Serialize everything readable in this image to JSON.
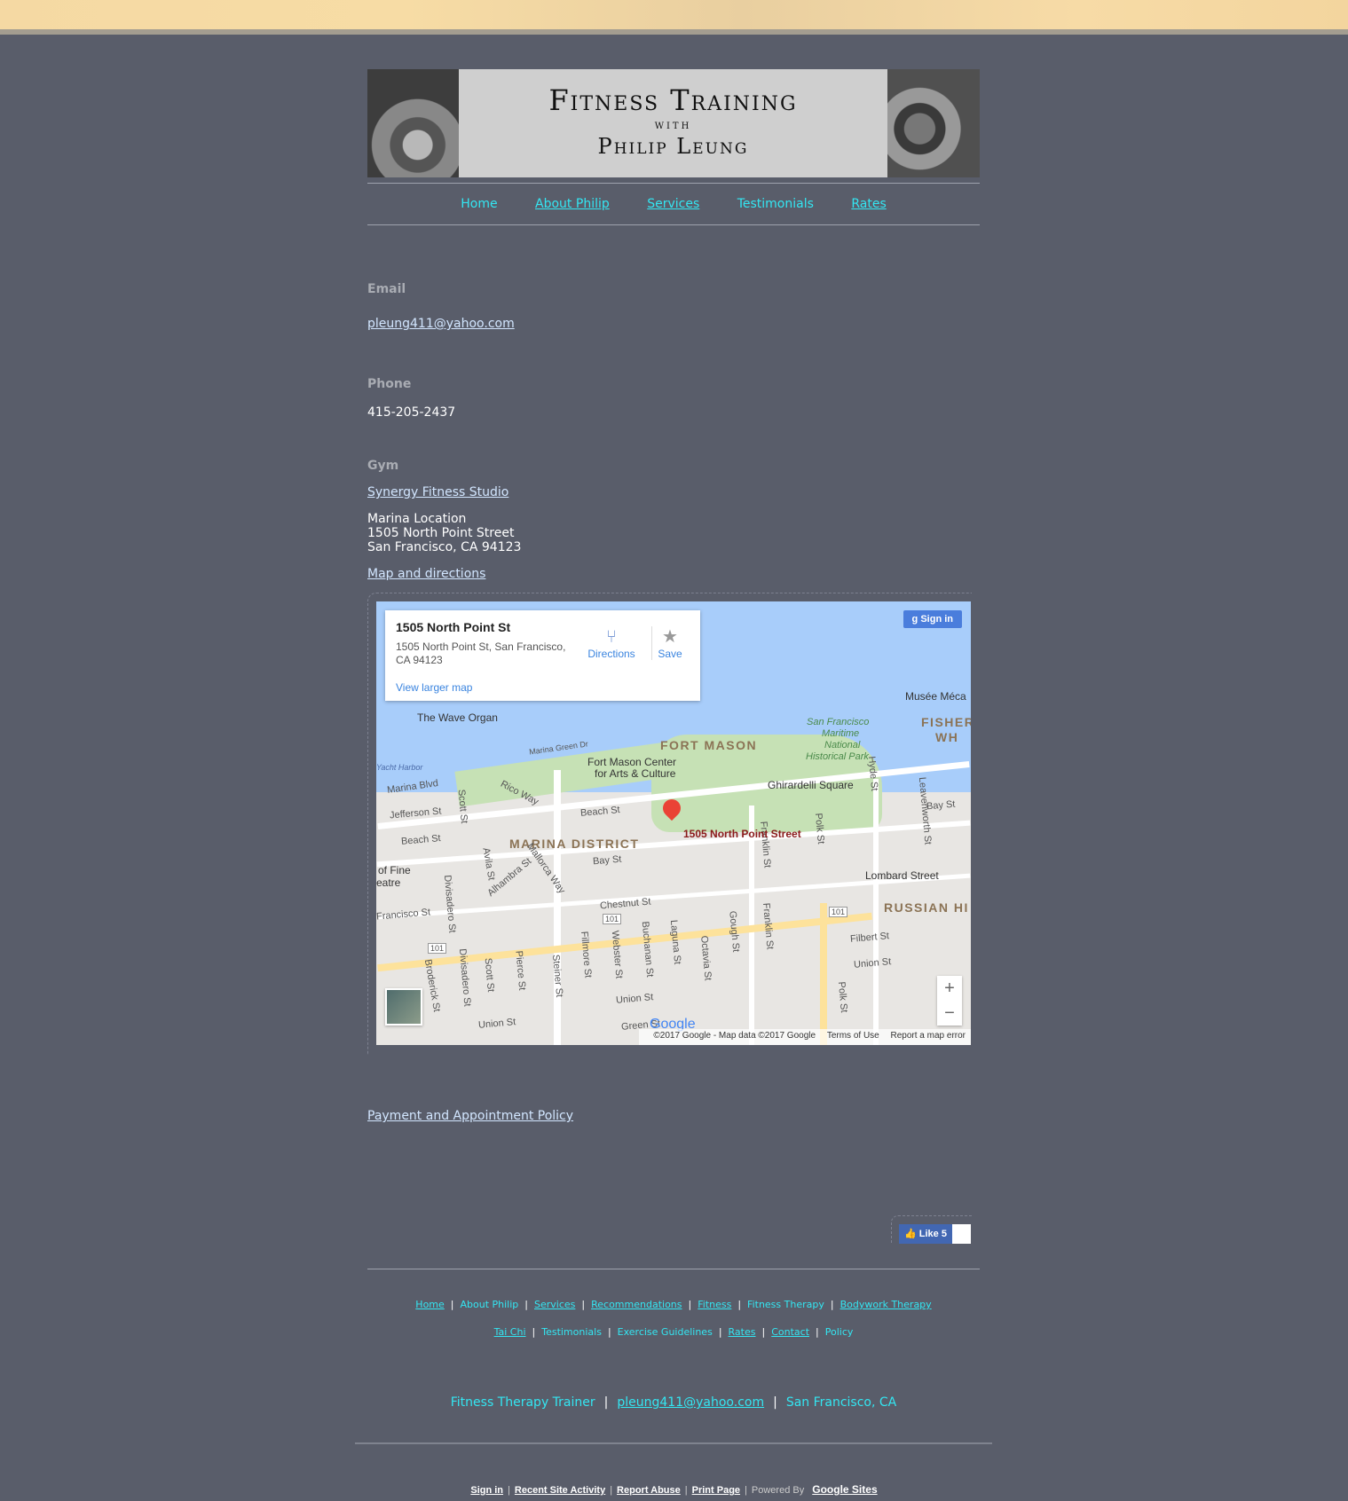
{
  "header": {
    "title_line1": "Fitness Training",
    "title_line2": "with",
    "title_line3": "Philip Leung"
  },
  "nav": {
    "items": [
      {
        "label": "Home"
      },
      {
        "label": "About Philip"
      },
      {
        "label": "Services"
      },
      {
        "label": "Testimonials"
      },
      {
        "label": "Rates"
      }
    ]
  },
  "contact": {
    "email_heading": "Email",
    "email": "pleung411@yahoo.com",
    "phone_heading": "Phone",
    "phone": "415-205-2437",
    "gym_heading": "Gym",
    "gym_name": "Synergy Fitness Studio",
    "gym_location": "Marina Location",
    "gym_street": "1505 North Point Street",
    "gym_city": "San Francisco, CA 94123",
    "map_link": "Map and directions"
  },
  "map": {
    "card_title": "1505 North Point St",
    "card_address": "1505 North Point St, San Francisco, CA 94123",
    "directions_label": "Directions",
    "save_label": "Save",
    "view_larger": "View larger map",
    "sign_in": "Sign in",
    "pin_label": "1505 North Point Street",
    "labels": {
      "wave_organ": "The Wave Organ",
      "fort_mason": "FORT MASON",
      "fort_mason_center": "Fort Mason Center",
      "arts_culture": "for Arts & Culture",
      "maritime1": "San Francisco",
      "maritime2": "Maritime",
      "maritime3": "National",
      "maritime4": "Historical Park",
      "ghirardelli": "Ghirardelli Square",
      "marina_district": "MARINA DISTRICT",
      "russian_hill": "RUSSIAN HI",
      "musee": "Musée Méca",
      "fisher1": "FISHER",
      "fisher2": "WH",
      "lombard": "Lombard Street",
      "yacht_harbor": "Yacht Harbor",
      "marina_blvd": "Marina Blvd",
      "marina_green": "Marina Green Dr",
      "jefferson": "Jefferson St",
      "beach_w": "Beach St",
      "beach": "Beach St",
      "bay": "Bay St",
      "bay_e": "Bay St",
      "chestnut": "Chestnut St",
      "francisco": "Francisco St",
      "filbert": "Filbert St",
      "union_w": "Union St",
      "union": "Union St",
      "union_e": "Union St",
      "green": "Green St",
      "fine_arts1": "of Fine",
      "fine_arts2": "eatre",
      "rico": "Rico Way",
      "mallorca": "Mallorca Way",
      "alhambra": "Alhambra St",
      "avila": "Avila St",
      "scott": "Scott St",
      "scott2": "Scott St",
      "divisadero": "Divisadero St",
      "divisadero2": "Divisadero St",
      "broderick": "Broderick St",
      "pierce": "Pierce St",
      "steiner": "Steiner St",
      "fillmore": "Fillmore St",
      "webster": "Webster St",
      "buchanan": "Buchanan St",
      "laguna": "Laguna St",
      "octavia": "Octavia St",
      "gough": "Gough St",
      "franklin": "Franklin St",
      "franklin2": "Franklin St",
      "polk": "Polk St",
      "polk2": "Polk St",
      "hyde": "Hyde St",
      "leavenworth": "Leavenworth St",
      "hwy1": "101",
      "hwy2": "101",
      "hwy3": "101"
    },
    "google_logo": "Google",
    "credit": "©2017 Google - Map data ©2017 Google",
    "terms": "Terms of Use",
    "report": "Report a map error"
  },
  "policy_link": "Payment and Appointment Policy",
  "like": {
    "label": "Like 5"
  },
  "footer_nav": {
    "row1": [
      "Home",
      "About Philip",
      "Services",
      "Recommendations",
      "Fitness",
      "Fitness Therapy",
      "Bodywork Therapy"
    ],
    "row2": [
      "Tai Chi",
      "Testimonials",
      "Exercise Guidelines",
      "Rates",
      "Contact",
      "Policy"
    ]
  },
  "tagline": {
    "role": "Fitness Therapy Trainer",
    "email": "pleung411@yahoo.com",
    "city": "San Francisco, CA"
  },
  "site_footer": {
    "sign_in": "Sign in",
    "recent": "Recent Site Activity",
    "report": "Report Abuse",
    "print": "Print Page",
    "powered": "Powered By",
    "google_sites": "Google Sites"
  }
}
